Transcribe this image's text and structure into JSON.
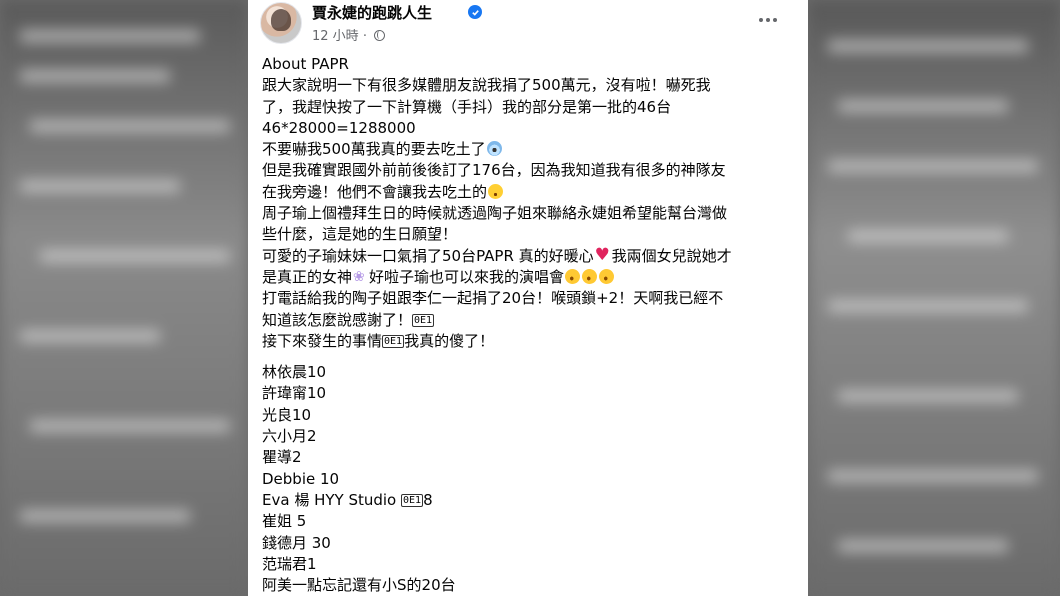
{
  "post": {
    "page_name": "賈永婕的跑跳人生",
    "timestamp": "12 小時",
    "meta_separator": "·",
    "lines": [
      "About PAPR",
      "跟大家說明一下有很多媒體朋友說我捐了500萬元，沒有啦！嚇死我",
      "了，我趕快按了一下計算機（手抖）我的部分是第一批的46台",
      "46*28000=1288000",
      "不要嚇我500萬我真的要去吃土了",
      "但是我確實跟國外前前後後訂了176台，因為我知道我有很多的神隊友",
      "在我旁邊！他們不會讓我去吃土的",
      "周子瑜上個禮拜生日的時候就透過陶子姐來聯絡永婕姐希望能幫台灣做",
      "些什麼，這是她的生日願望！",
      "可愛的子瑜妹妹一口氣捐了50台PAPR 真的好暖心",
      "我兩個女兒說她才",
      "是真正的女神",
      "好啦子瑜也可以來我的演唱會",
      "打電話給我的陶子姐跟李仁一起捐了20台！喉頭鎖+2！天啊我已經不",
      "知道該怎麼說感謝了！",
      "接下來發生的事情",
      "我真的傻了！"
    ],
    "placeholder_glyph": "0E1",
    "donors": [
      "林依晨10",
      "許瑋甯10",
      "光良10",
      "六小月2",
      "瞿導2",
      "Debbie 10",
      "Eva 楊 HYY Studio ",
      "8",
      "崔姐 5",
      "錢德月 30",
      "范瑞君1",
      "阿美一點忘記還有小S的20台"
    ]
  },
  "icons": {
    "verified": "verified-badge-icon",
    "globe": "globe-icon",
    "more": "more-options-icon"
  },
  "colors": {
    "text": "#050505",
    "secondary_text": "#65676b",
    "verified_blue": "#1877f2",
    "card_background": "#ffffff"
  }
}
